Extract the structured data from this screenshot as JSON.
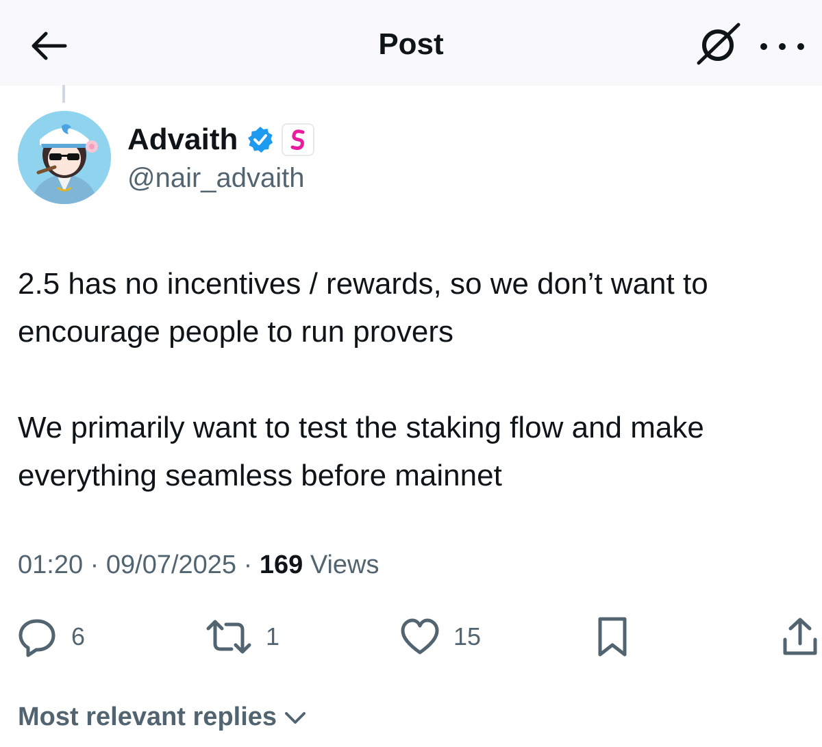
{
  "header": {
    "title": "Post"
  },
  "icons": {
    "back": "back-arrow-icon",
    "grok": "grok-icon",
    "more": "more-dots-icon",
    "verified": "verified-badge-icon",
    "affiliate": "affiliate-badge-icon",
    "reply": "reply-icon",
    "repost": "repost-icon",
    "like": "like-icon",
    "bookmark": "bookmark-icon",
    "share": "share-icon",
    "chevron": "chevron-down-icon"
  },
  "author": {
    "name": "Advaith",
    "handle": "@nair_advaith"
  },
  "post": {
    "paragraphs": [
      "2.5 has no incentives / rewards, so we don’t want to encourage people to run provers",
      "We primarily want to test the staking flow and make everything seamless before mainnet"
    ],
    "time": "01:20",
    "date": "09/07/2025",
    "views_count": "169",
    "views_label": "Views"
  },
  "actions": {
    "replies": "6",
    "reposts": "1",
    "likes": "15"
  },
  "replies_sort": {
    "label": "Most relevant replies"
  },
  "colors": {
    "text": "#0f1419",
    "secondary": "#536471",
    "verified": "#1d9bf0",
    "affiliate": "#ec1b9d"
  }
}
